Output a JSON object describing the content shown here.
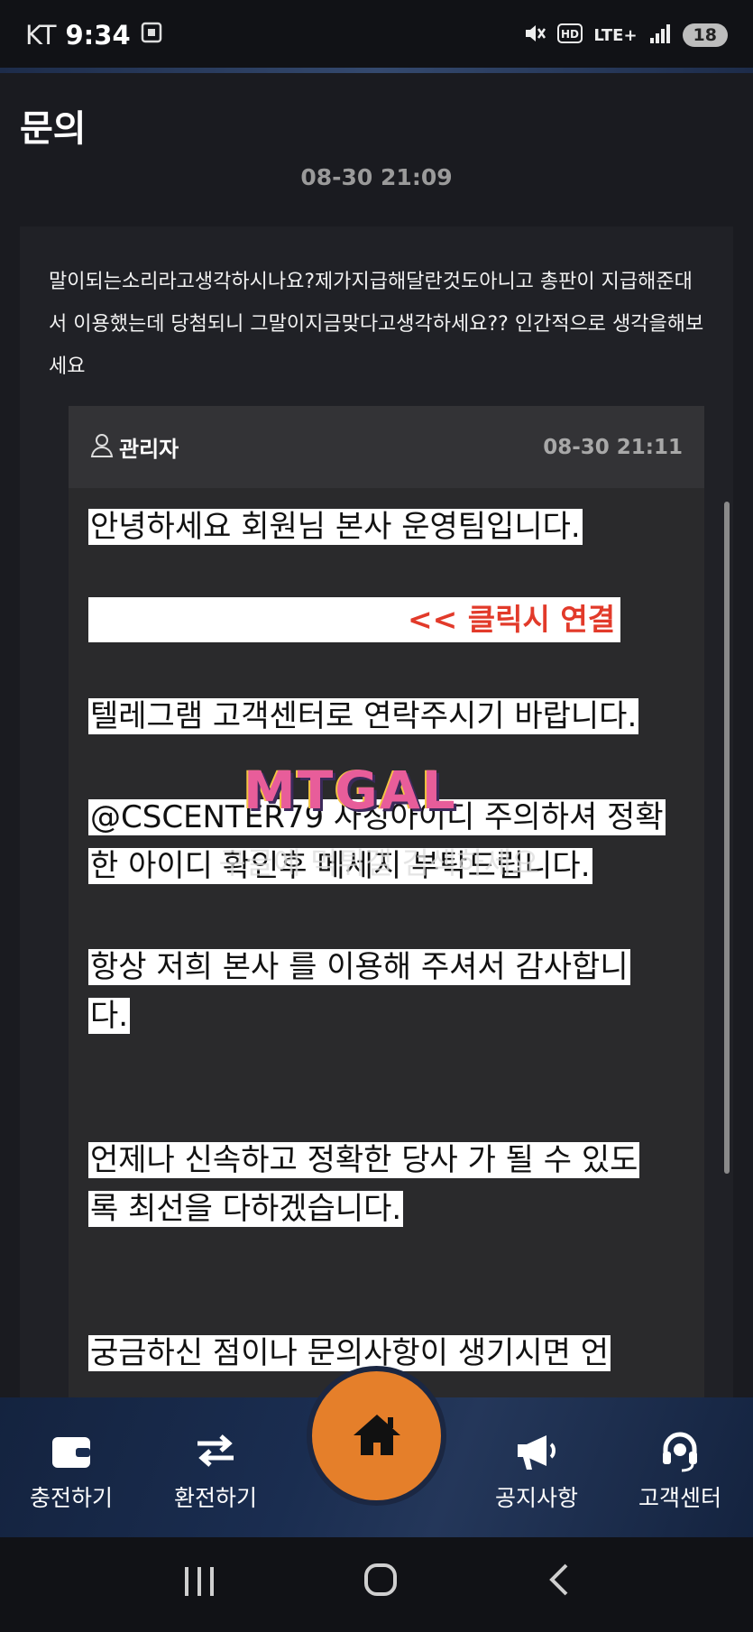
{
  "status_bar": {
    "carrier": "KT",
    "time": "9:34",
    "network": "LTE+",
    "battery": "18"
  },
  "page": {
    "title": "문의",
    "post_time": "08-30 21:09"
  },
  "question": {
    "text": "말이되는소리라고생각하시나요?제가지급해달란것도아니고 총판이 지급해준대서 이용했는데 당첨되니 그말이지금맞다고생각하세요?? 인간적으로 생각을해보세요"
  },
  "reply": {
    "author": "관리자",
    "time": "08-30 21:11",
    "greeting": "안녕하세요 회원님 본사 운영팀입니다.",
    "link_label": "<< 클릭시 연결",
    "line_telegram": "텔레그램 고객센터로 연락주시기 바랍니다.",
    "line_id": "@CSCENTER79   사칭아이디 주의하셔 정확한 아이디 확인후 메세지 부탁드립니다.",
    "line_thanks": " 항상 저희 본사 를 이용해 주셔서 감사합니다.",
    "line_best": "언제나 신속하고 정확한 당사 가 될 수 있도록 최선을 다하겠습니다.",
    "line_cut": "궁금하신 점이나 문의사항이 생기시면 언"
  },
  "watermark": {
    "logo": "MTGAL",
    "sub": "구글에 먹튀갤 검색하세요"
  },
  "bottom_nav": {
    "items": [
      {
        "label": "충전하기",
        "icon": "wallet-icon"
      },
      {
        "label": "환전하기",
        "icon": "exchange-arrows-icon"
      },
      {
        "label": "",
        "icon": "home-icon"
      },
      {
        "label": "공지사항",
        "icon": "megaphone-icon"
      },
      {
        "label": "고객센터",
        "icon": "headset-icon"
      }
    ],
    "home_color": "#e57f2a"
  }
}
